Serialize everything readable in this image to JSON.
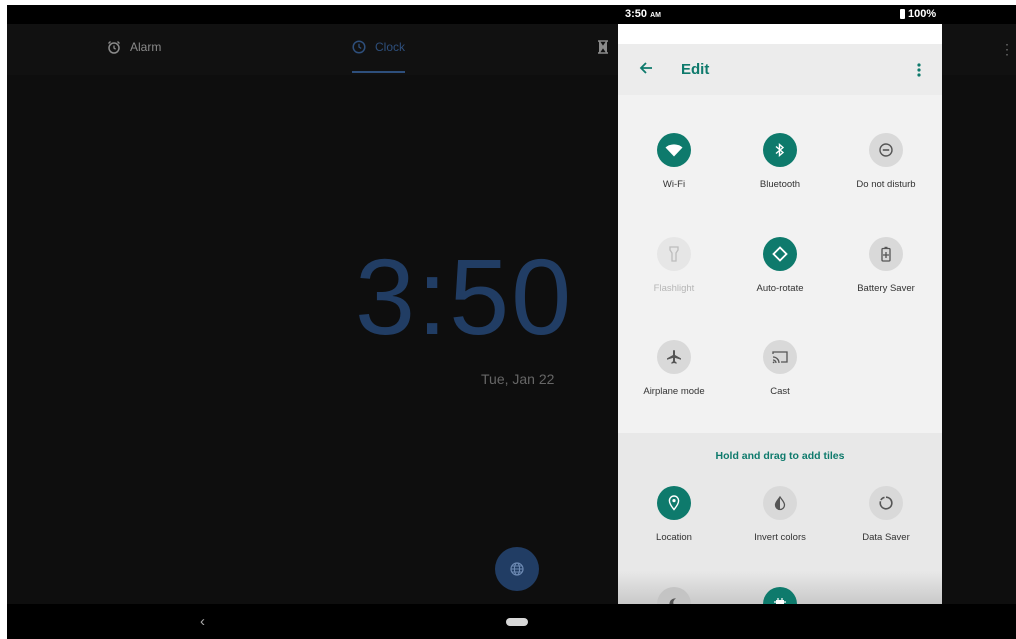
{
  "status_bar": {
    "time": "3:50",
    "ampm": "AM",
    "battery": "100%"
  },
  "clock_app": {
    "tabs": [
      {
        "label": "Alarm",
        "icon": "alarm-icon"
      },
      {
        "label": "Clock",
        "icon": "clock-icon",
        "selected": true
      },
      {
        "label": "",
        "icon": "hourglass-icon"
      }
    ],
    "time": "3:50",
    "date": "Tue, Jan 22",
    "fab_icon": "globe-icon",
    "colors": {
      "accent": "#213d64",
      "background": "#0e0e0e"
    }
  },
  "edit_panel": {
    "title": "Edit",
    "accent": "#0e7a6c",
    "active_tiles": [
      {
        "label": "Wi-Fi",
        "icon": "wifi-icon",
        "state": "on"
      },
      {
        "label": "Bluetooth",
        "icon": "bluetooth-icon",
        "state": "on"
      },
      {
        "label": "Do not disturb",
        "icon": "do-not-disturb-icon",
        "state": "off"
      },
      {
        "label": "Flashlight",
        "icon": "flashlight-icon",
        "state": "disabled"
      },
      {
        "label": "Auto-rotate",
        "icon": "auto-rotate-icon",
        "state": "on"
      },
      {
        "label": "Battery Saver",
        "icon": "battery-saver-icon",
        "state": "off"
      },
      {
        "label": "Airplane mode",
        "icon": "airplane-icon",
        "state": "off"
      },
      {
        "label": "Cast",
        "icon": "cast-icon",
        "state": "off"
      }
    ],
    "add_header": "Hold and drag to add tiles",
    "add_tiles": [
      {
        "label": "Location",
        "icon": "location-icon",
        "state": "on"
      },
      {
        "label": "Invert colors",
        "icon": "invert-colors-icon",
        "state": "off"
      },
      {
        "label": "Data Saver",
        "icon": "data-saver-icon",
        "state": "off"
      },
      {
        "label": "",
        "icon": "night-mode-icon",
        "state": "off"
      },
      {
        "label": "",
        "icon": "chip-icon",
        "state": "on"
      }
    ]
  },
  "nav_bar": {
    "back_icon": "back-icon",
    "home_icon": "home-pill-icon"
  }
}
